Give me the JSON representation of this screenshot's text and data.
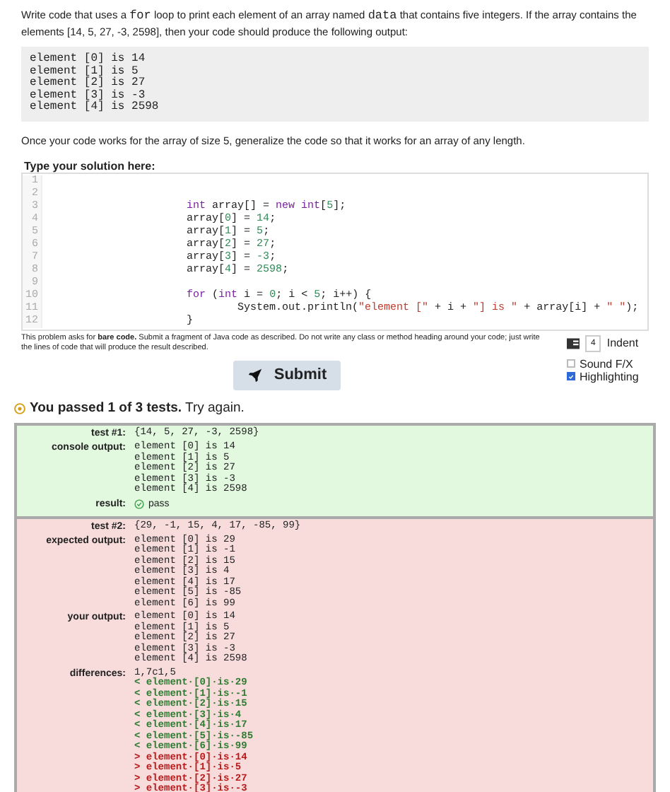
{
  "prompt": [
    {
      "kind": "text",
      "text": "Write code that uses a "
    },
    {
      "kind": "code",
      "text": "for"
    },
    {
      "kind": "text",
      "text": " loop to print each element of an array named "
    },
    {
      "kind": "code",
      "text": "data"
    },
    {
      "kind": "text",
      "text": " that contains five integers. If the array contains the elements [14, 5, 27, -3, 2598], then your code should produce the following output:"
    }
  ],
  "sample_output": [
    "element [0] is 14",
    "element [1] is 5",
    "element [2] is 27",
    "element [3] is -3",
    "element [4] is 2598"
  ],
  "followup": "Once your code works for the array of size 5, generalize the code so that it works for an array of any length.",
  "editor": {
    "title": "Type your solution here:",
    "lines": [
      {
        "number": "1"
      },
      {
        "number": "2"
      },
      {
        "number": "3",
        "kind": "statement",
        "segments": [
          {
            "kind": "keyword",
            "text": "int"
          },
          {
            "kind": "plain",
            "text": " array[] = "
          },
          {
            "kind": "keyword",
            "text": "new int"
          },
          {
            "kind": "plain",
            "text": "["
          },
          {
            "kind": "number",
            "text": "5"
          },
          {
            "kind": "plain",
            "text": "];"
          }
        ]
      },
      {
        "number": "4",
        "kind": "statement",
        "segments": [
          {
            "kind": "plain",
            "text": "array["
          },
          {
            "kind": "number",
            "text": "0"
          },
          {
            "kind": "plain",
            "text": "] = "
          },
          {
            "kind": "number",
            "text": "14"
          },
          {
            "kind": "plain",
            "text": ";"
          }
        ]
      },
      {
        "number": "5",
        "kind": "statement",
        "segments": [
          {
            "kind": "plain",
            "text": "array["
          },
          {
            "kind": "number",
            "text": "1"
          },
          {
            "kind": "plain",
            "text": "] = "
          },
          {
            "kind": "number",
            "text": "5"
          },
          {
            "kind": "plain",
            "text": ";"
          }
        ]
      },
      {
        "number": "6",
        "kind": "statement",
        "segments": [
          {
            "kind": "plain",
            "text": "array["
          },
          {
            "kind": "number",
            "text": "2"
          },
          {
            "kind": "plain",
            "text": "] = "
          },
          {
            "kind": "number",
            "text": "27"
          },
          {
            "kind": "plain",
            "text": ";"
          }
        ]
      },
      {
        "number": "7",
        "kind": "statement",
        "segments": [
          {
            "kind": "plain",
            "text": "array["
          },
          {
            "kind": "number",
            "text": "3"
          },
          {
            "kind": "plain",
            "text": "] = "
          },
          {
            "kind": "number",
            "text": "-3"
          },
          {
            "kind": "plain",
            "text": ";"
          }
        ]
      },
      {
        "number": "8",
        "kind": "statement",
        "segments": [
          {
            "kind": "plain",
            "text": "array["
          },
          {
            "kind": "number",
            "text": "4"
          },
          {
            "kind": "plain",
            "text": "] = "
          },
          {
            "kind": "number",
            "text": "2598"
          },
          {
            "kind": "plain",
            "text": ";"
          }
        ]
      },
      {
        "number": "9"
      },
      {
        "number": "10",
        "kind": "statement",
        "segments": [
          {
            "kind": "keyword",
            "text": "for"
          },
          {
            "kind": "plain",
            "text": " ("
          },
          {
            "kind": "keyword",
            "text": "int"
          },
          {
            "kind": "plain",
            "text": " i = "
          },
          {
            "kind": "number",
            "text": "0"
          },
          {
            "kind": "plain",
            "text": "; i < "
          },
          {
            "kind": "number",
            "text": "5"
          },
          {
            "kind": "plain",
            "text": "; i++) {"
          }
        ]
      },
      {
        "number": "11",
        "kind": "nested",
        "segments": [
          {
            "kind": "plain",
            "text": "System.out.println("
          },
          {
            "kind": "string",
            "text": "\"element [\""
          },
          {
            "kind": "plain",
            "text": " + i + "
          },
          {
            "kind": "string",
            "text": "\"] is \""
          },
          {
            "kind": "plain",
            "text": " + array[i] + "
          },
          {
            "kind": "string",
            "text": "\" \""
          },
          {
            "kind": "plain",
            "text": ");"
          }
        ]
      },
      {
        "number": "12",
        "kind": "statement",
        "segments": [
          {
            "kind": "plain",
            "text": "}"
          }
        ]
      }
    ]
  },
  "note": "This problem asks for **bare code.** Submit a fragment of Java code as described. Do not write any class or method heading around your code; just write the lines of code that will produce the result described.",
  "indent": {
    "value": "4",
    "label": "Indent"
  },
  "submit": {
    "label": "Submit"
  },
  "options": [
    {
      "label": "Sound F/X",
      "checked": false
    },
    {
      "label": "Highlighting",
      "checked": true
    }
  ],
  "summary": "**You passed 1 of 3 tests.** Try again.",
  "tests": [
    {
      "kind": "pass",
      "rows": [
        {
          "label": "test #1:",
          "kind": "code",
          "lines": [
            {
              "kind": "plain",
              "text": "{14, 5, 27, -3, 2598}"
            }
          ]
        },
        {
          "label": "console output:",
          "kind": "code",
          "lines": [
            {
              "kind": "plain",
              "text": "element [0] is 14"
            },
            {
              "kind": "plain",
              "text": "element [1] is 5"
            },
            {
              "kind": "plain",
              "text": "element [2] is 27"
            },
            {
              "kind": "plain",
              "text": "element [3] is -3"
            },
            {
              "kind": "plain",
              "text": "element [4] is 2598"
            }
          ]
        },
        {
          "label": "result:",
          "kind": "result",
          "passed": true,
          "text": "pass"
        }
      ]
    },
    {
      "kind": "fail",
      "rows": [
        {
          "label": "test #2:",
          "kind": "code",
          "lines": [
            {
              "kind": "plain",
              "text": "{29, -1, 15, 4, 17, -85, 99}"
            }
          ]
        },
        {
          "label": "expected output:",
          "kind": "code",
          "lines": [
            {
              "kind": "plain",
              "text": "element [0] is 29"
            },
            {
              "kind": "plain",
              "text": "element [1] is -1"
            },
            {
              "kind": "plain",
              "text": "element [2] is 15"
            },
            {
              "kind": "plain",
              "text": "element [3] is 4"
            },
            {
              "kind": "plain",
              "text": "element [4] is 17"
            },
            {
              "kind": "plain",
              "text": "element [5] is -85"
            },
            {
              "kind": "plain",
              "text": "element [6] is 99"
            }
          ]
        },
        {
          "label": "your output:",
          "kind": "code",
          "lines": [
            {
              "kind": "plain",
              "text": "element [0] is 14"
            },
            {
              "kind": "plain",
              "text": "element [1] is 5"
            },
            {
              "kind": "plain",
              "text": "element [2] is 27"
            },
            {
              "kind": "plain",
              "text": "element [3] is -3"
            },
            {
              "kind": "plain",
              "text": "element [4] is 2598"
            }
          ]
        },
        {
          "label": "differences:",
          "kind": "code",
          "lines": [
            {
              "kind": "plain",
              "text": "1,7c1,5"
            },
            {
              "kind": "expected",
              "text": "< element·[0]·is·29"
            },
            {
              "kind": "expected",
              "text": "< element·[1]·is·-1"
            },
            {
              "kind": "expected",
              "text": "< element·[2]·is·15"
            },
            {
              "kind": "expected",
              "text": "< element·[3]·is·4"
            },
            {
              "kind": "expected",
              "text": "< element·[4]·is·17"
            },
            {
              "kind": "expected",
              "text": "< element·[5]·is·-85"
            },
            {
              "kind": "expected",
              "text": "< element·[6]·is·99"
            },
            {
              "kind": "actual",
              "text": "> element·[0]·is·14"
            },
            {
              "kind": "actual",
              "text": "> element·[1]·is·5"
            },
            {
              "kind": "actual",
              "text": "> element·[2]·is·27"
            },
            {
              "kind": "actual",
              "text": "> element·[3]·is·-3"
            }
          ]
        }
      ]
    }
  ]
}
